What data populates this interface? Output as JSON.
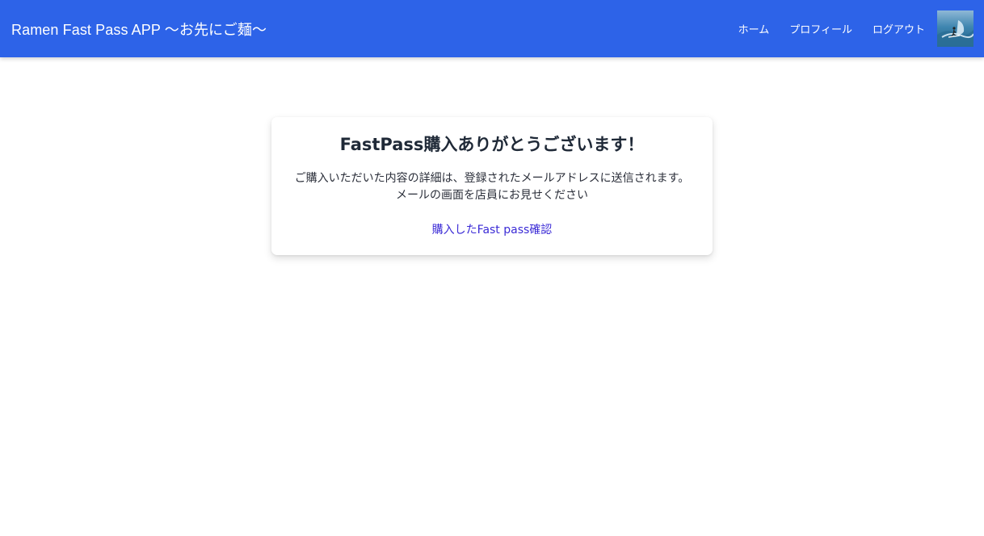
{
  "app": {
    "title": "Ramen Fast Pass APP 〜お先にご麺〜"
  },
  "nav": {
    "items": [
      {
        "label": "ホーム"
      },
      {
        "label": "プロフィール"
      },
      {
        "label": "ログアウト"
      }
    ],
    "avatar_icon": "user-avatar-surfer-photo"
  },
  "card": {
    "title": "FastPass購入ありがとうございます！",
    "message_line1": "ご購入いただいた内容の詳細は、登録されたメールアドレスに送信されます。",
    "message_line2": "メールの画面を店員にお見せください",
    "link_label": "購入したFast pass確認"
  },
  "colors": {
    "navbar": "#2d63e8",
    "link": "#3b2bd6",
    "title_text": "#1f2937"
  }
}
